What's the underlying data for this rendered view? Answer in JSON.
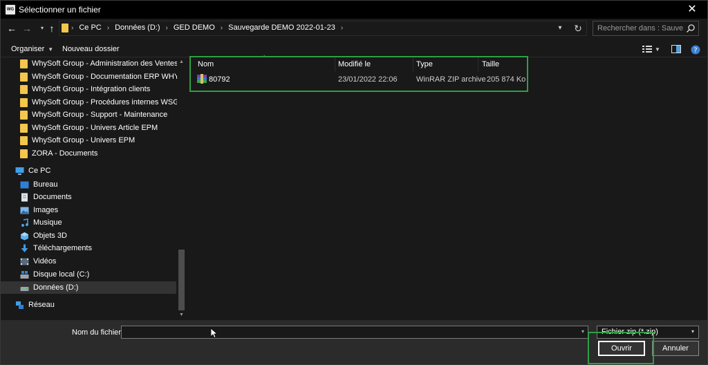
{
  "window": {
    "title": "Sélectionner un fichier",
    "app_icon_text": "WG"
  },
  "nav": {
    "breadcrumbs": [
      "Ce PC",
      "Données (D:)",
      "GED DEMO",
      "Sauvegarde DEMO 2022-01-23"
    ],
    "search_placeholder": "Rechercher dans : Sauvegarde..."
  },
  "toolbar": {
    "organize_label": "Organiser",
    "new_folder_label": "Nouveau dossier"
  },
  "sidebar": {
    "folders": [
      "WhySoft Group - Administration des Ventes",
      "WhySoft Group - Documentation ERP WHY",
      "WhySoft Group - Intégration clients",
      "WhySoft Group - Procédures internes WSG",
      "WhySoft Group - Support - Maintenance",
      "WhySoft Group - Univers Article EPM",
      "WhySoft Group - Univers EPM",
      "ZORA - Documents"
    ],
    "this_pc": "Ce PC",
    "pc_items": [
      "Bureau",
      "Documents",
      "Images",
      "Musique",
      "Objets 3D",
      "Téléchargements",
      "Vidéos",
      "Disque local (C:)",
      "Données (D:)"
    ],
    "network": "Réseau"
  },
  "file_list": {
    "columns": [
      "Nom",
      "Modifié le",
      "Type",
      "Taille"
    ],
    "rows": [
      {
        "name": "80792",
        "modified": "23/01/2022 22:06",
        "type": "WinRAR ZIP archive",
        "size": "205 874 Ko"
      }
    ]
  },
  "footer": {
    "filename_label": "Nom du fichier :",
    "filename_value": "",
    "file_type": "Fichier zip (*.zip)",
    "open_label": "Ouvrir",
    "cancel_label": "Annuler"
  },
  "colors": {
    "highlight": "#2ea043",
    "folder": "#f3c64c",
    "background": "#191919"
  }
}
